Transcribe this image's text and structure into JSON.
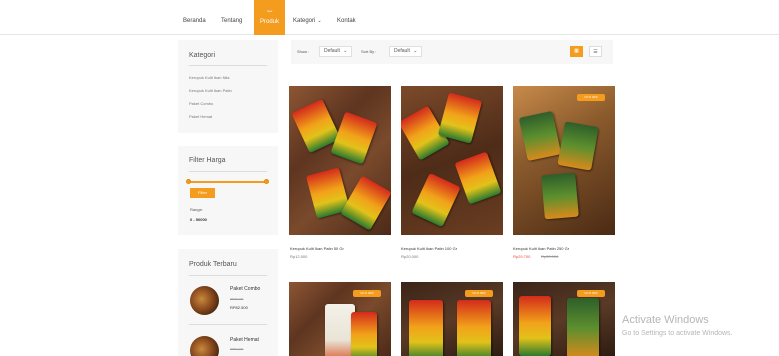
{
  "nav": {
    "items": [
      {
        "label": "Beranda"
      },
      {
        "label": "Tentang"
      },
      {
        "label": "Produk",
        "badge": "new"
      },
      {
        "label": "Kategori"
      },
      {
        "label": "Kontak"
      }
    ],
    "accent": "#f39c1e"
  },
  "sidebar": {
    "categories": {
      "title": "Kategori",
      "items": [
        "Kerupuk Kulit Ikan Nila",
        "Kerupuk Kulit Ikan Patin",
        "Paket Combo",
        "Paket Hemat"
      ]
    },
    "price_filter": {
      "title": "Filter Harga",
      "button": "Filter",
      "range_label": "Range:",
      "range_value": "0 - 50000",
      "range_min_fraction": 0.0,
      "range_max_fraction": 1.0
    },
    "recent": {
      "title": "Produk Terbaru",
      "items": [
        {
          "name": "Paket Combo",
          "old_price": "RP95.000",
          "price": "RP82.500"
        },
        {
          "name": "Paket Hemat",
          "old_price": "RP50.000",
          "price": ""
        }
      ]
    }
  },
  "toolbar": {
    "show_label": "Show :",
    "show_value": "Default",
    "sort_label": "Sort By :",
    "sort_value": "Default",
    "grid_icon": "grid-icon",
    "list_icon": "list-icon"
  },
  "products": [
    {
      "name": "Kerupuk Kulit Ikan Patin 50 Gr",
      "price": "Rp12.500",
      "old_price": "",
      "badge": ""
    },
    {
      "name": "Kerupuk Kulit Ikan Patin 100 Gr",
      "price": "Rp20.000",
      "old_price": "",
      "badge": ""
    },
    {
      "name": "Kerupuk Kulit Ikan Patin 250 Gr",
      "price": "Rp29.700",
      "old_price": "Rp33.000",
      "badge": "10 % OFF"
    },
    {
      "badge": "10 % OFF"
    },
    {
      "badge": "10 % OFF"
    },
    {
      "badge": "10 % OFF"
    }
  ],
  "watermark": {
    "title": "Activate Windows",
    "subtitle": "Go to Settings to activate Windows."
  }
}
